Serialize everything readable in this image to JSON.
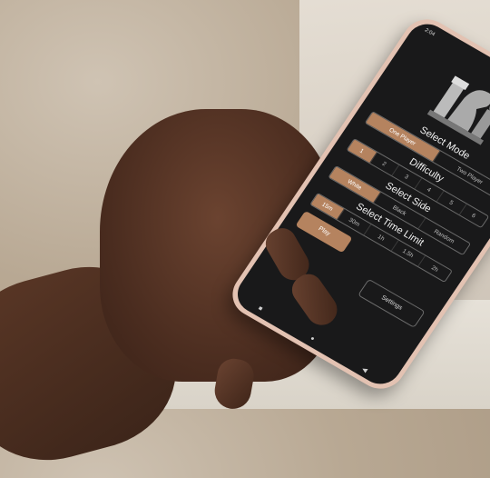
{
  "status_bar": {
    "time": "2:04"
  },
  "screen": {
    "mode": {
      "title": "Select Mode",
      "options": [
        "One Player",
        "Two Player"
      ],
      "selected": "One Player"
    },
    "difficulty": {
      "title": "Difficulty",
      "options": [
        "1",
        "2",
        "3",
        "4",
        "5",
        "6"
      ],
      "selected": "1"
    },
    "side": {
      "title": "Select Side",
      "options": [
        "White",
        "Black",
        "Random"
      ],
      "selected": "White"
    },
    "time_limit": {
      "title": "Select Time Limit",
      "options": [
        "15m",
        "30m",
        "1h",
        "1.5h",
        "2h"
      ],
      "selected": "15m"
    },
    "play_label": "Play",
    "settings_label": "Settings"
  },
  "nav": {
    "recent": "■",
    "home": "●",
    "back": "◀"
  },
  "colors": {
    "accent": "#b5835f",
    "screen_bg": "#19191a",
    "phone_case": "#e3c2b2"
  },
  "icons": {
    "logo": "chess-pieces-logo-icon"
  }
}
